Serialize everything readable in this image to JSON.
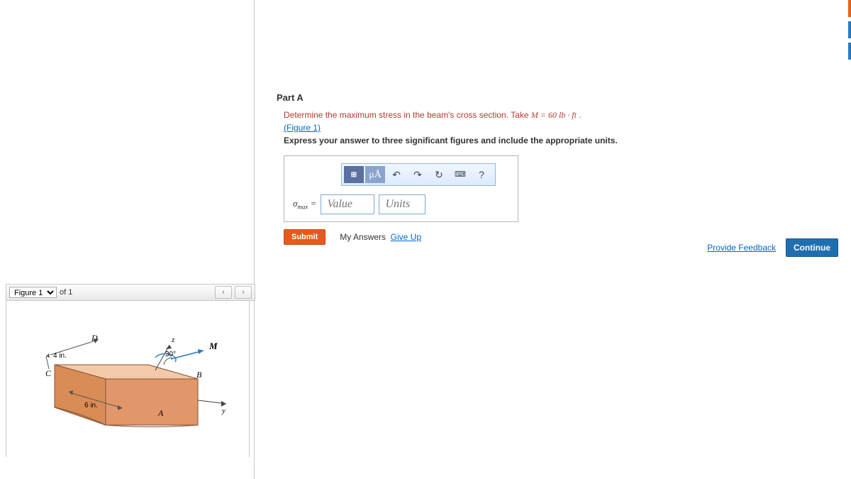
{
  "part": {
    "title": "Part A",
    "prompt_pre": "Determine the maximum stress in the beam's cross section. Take ",
    "prompt_eq": "M = 60  lb · ft",
    "prompt_post": " .",
    "figure_link": "(Figure 1)",
    "instruction": "Express your answer to three significant figures and include the appropriate units."
  },
  "toolbar": {
    "templates": "⊞",
    "mu": "μÅ",
    "undo": "↶",
    "redo": "↷",
    "reset": "↻",
    "keyboard": "⌨",
    "help": "?"
  },
  "answer": {
    "label_html": "σ",
    "label_sub": "max",
    "equals": " = ",
    "value_ph": "Value",
    "units_ph": "Units"
  },
  "actions": {
    "submit": "Submit",
    "my_answers": "My Answers",
    "give_up": "Give Up",
    "feedback": "Provide Feedback",
    "continue": "Continue"
  },
  "figure_panel": {
    "select": "Figure 1",
    "of": "of 1",
    "prev": "‹",
    "next": "›"
  },
  "figure_labels": {
    "D": "D",
    "C": "C",
    "B": "B",
    "A": "A",
    "M": "M",
    "z": "z",
    "y": "y",
    "angle": "30°",
    "dim4": "4 in.",
    "dim6": "6 in."
  }
}
